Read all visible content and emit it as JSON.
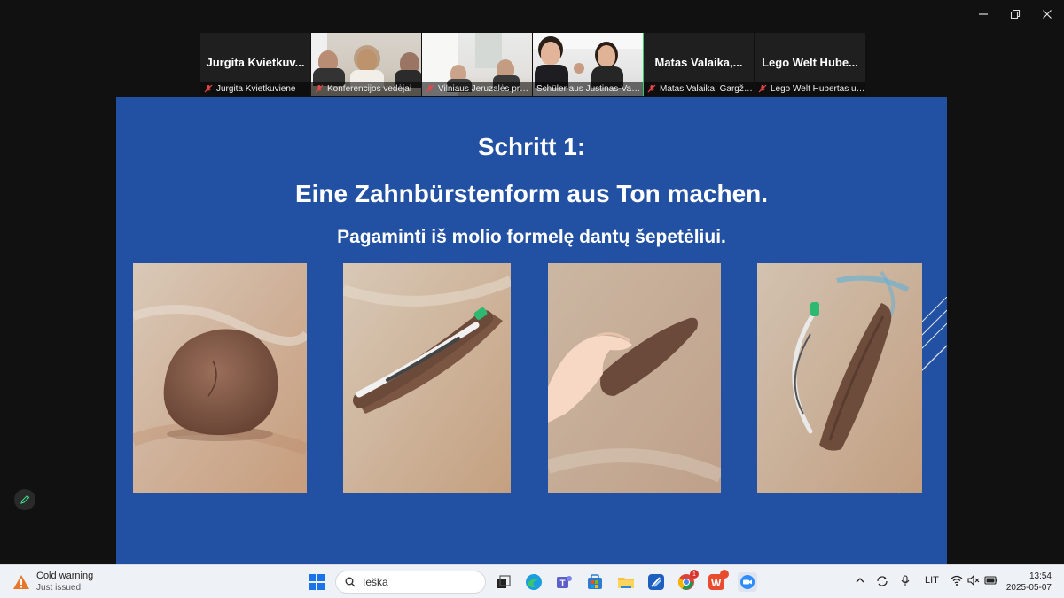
{
  "window": {
    "controls": [
      "minimize-icon",
      "restore-icon",
      "close-icon"
    ]
  },
  "participants": [
    {
      "big_name": "Jurgita  Kvietkuv...",
      "caption": "Jurgita Kvietkuvienė",
      "video": false,
      "muted": true
    },
    {
      "big_name": "",
      "caption": "Konferencijos vedėjai",
      "video": true,
      "muted": true
    },
    {
      "big_name": "",
      "caption": "Vilniaus Jeruzalės prog...",
      "video": true,
      "muted": true
    },
    {
      "big_name": "",
      "caption": "Schüler aus Justinas-Varei...",
      "video": true,
      "muted": false,
      "active": true
    },
    {
      "big_name": "Matas  Valaika,...",
      "caption": "Matas Valaika, Gargžd...",
      "video": false,
      "muted": true
    },
    {
      "big_name": "Lego  Welt  Hube...",
      "caption": "Lego Welt Hubertas un...",
      "video": false,
      "muted": true
    }
  ],
  "slide": {
    "title": "Schritt 1:",
    "subtitle_de": "Eine Zahnbürstenform aus Ton machen.",
    "subtitle_lt": "Pagaminti iš molio formelę dantų šepetėliui.",
    "background": "#2251a3",
    "photos": [
      "clay-ball",
      "toothbrush-in-clay",
      "hand-shaping-clay",
      "toothbrush-and-mold"
    ]
  },
  "taskbar": {
    "weather_title": "Cold warning",
    "weather_sub": "Just issued",
    "search_placeholder": "Ieška",
    "language": "LIT",
    "time": "13:54",
    "date": "2025-05-07",
    "notification_count": "1"
  }
}
